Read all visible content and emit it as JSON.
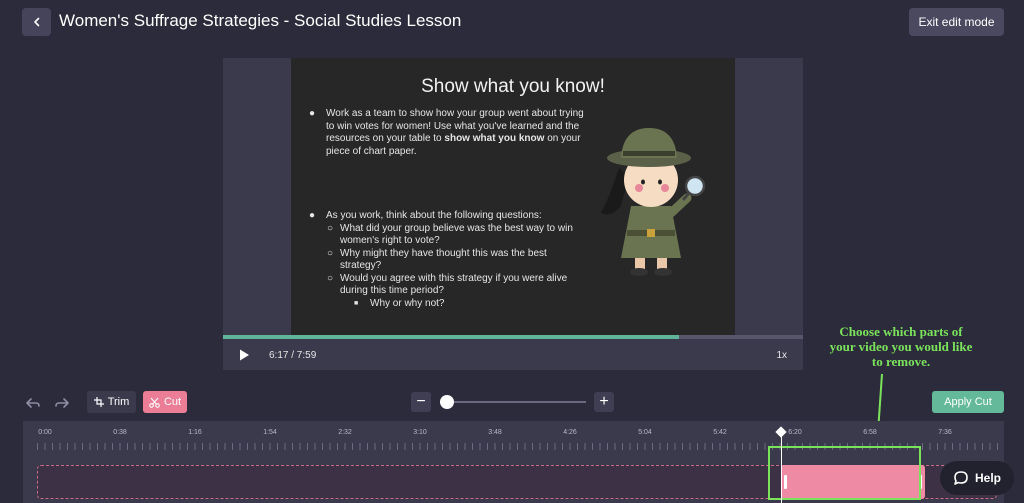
{
  "header": {
    "title": "Women's Suffrage Strategies - Social Studies Lesson",
    "exit_label": "Exit edit mode"
  },
  "slide": {
    "heading": "Show what you know!",
    "bullet1_pre": "Work as a team to show how your group went about trying to win votes for women! Use what you've learned and the resources on your table to ",
    "bullet1_bold": "show what you know",
    "bullet1_post": " on your piece of chart paper.",
    "bullet2": "As you work, think about the following questions:",
    "sub1": "What did your group believe was the best way to win women's right to vote?",
    "sub2": "Why might they have thought this was the best strategy?",
    "sub3": "Would you agree with this strategy if you were alive during this time period?",
    "subsub1": "Why or why not?"
  },
  "player": {
    "timecode": "6:17 / 7:59",
    "speed": "1x",
    "progress": 0.787
  },
  "annotation": {
    "text": "Choose which parts of your video you would like to remove."
  },
  "toolbar": {
    "trim_label": "Trim",
    "cut_label": "Cut",
    "apply_label": "Apply Cut",
    "zoom_level": 0
  },
  "timeline": {
    "duration_seconds": 479,
    "playhead_seconds": 377,
    "cut_start_seconds": 377,
    "cut_end_seconds": 450,
    "tick_labels": [
      "0:00",
      "0:38",
      "1:16",
      "1:54",
      "2:32",
      "3:10",
      "3:48",
      "4:26",
      "5:04",
      "5:42",
      "6:20",
      "6:58",
      "7:36"
    ]
  },
  "help": {
    "label": "Help"
  },
  "colors": {
    "background": "#2c2b3b",
    "accent_pink": "#ec7d96",
    "accent_green": "#63b99a",
    "annotation_green": "#7be35b"
  },
  "icons": [
    "back-arrow-icon",
    "play-icon",
    "undo-icon",
    "redo-icon",
    "trim-icon",
    "scissors-icon",
    "chat-bubble-icon"
  ]
}
